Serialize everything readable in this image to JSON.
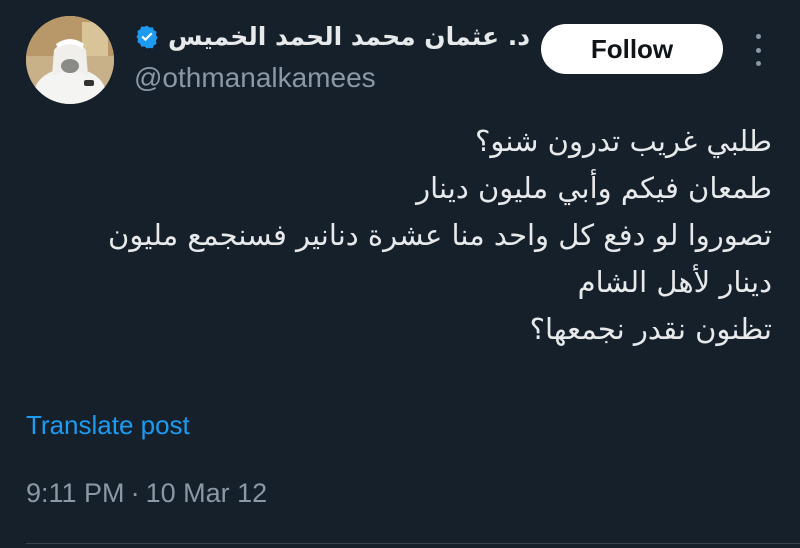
{
  "author": {
    "display_name": "د. عثمان محمد الحمد الخميس",
    "handle": "@othmanalkamees",
    "verified_icon": "verified-badge-icon",
    "verified_color": "#1d9bf0"
  },
  "actions": {
    "follow_label": "Follow",
    "more_icon": "more-vertical-icon"
  },
  "tweet": {
    "lines": [
      "طلبي غريب تدرون شنو؟",
      "طمعان فيكم وأبي مليون دينار",
      "تصوروا لو دفع كل واحد منا عشرة دنانير فسنجمع مليون",
      "دينار لأهل الشام",
      "تظنون نقدر نجمعها؟"
    ],
    "translate_label": "Translate post"
  },
  "meta": {
    "time": "9:11 PM",
    "separator": "·",
    "date": "10 Mar 12"
  },
  "colors": {
    "background": "#15202b",
    "text": "#e7e9ea",
    "secondary": "#8b98a5",
    "link": "#1d9bf0"
  }
}
